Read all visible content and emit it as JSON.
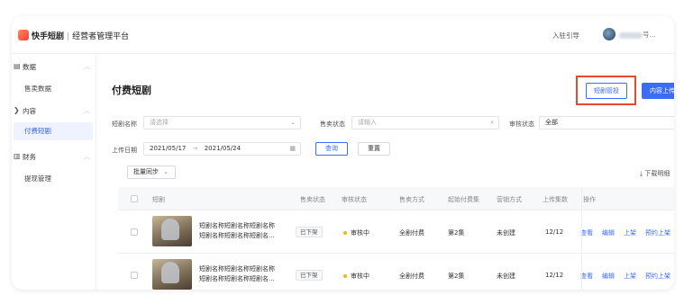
{
  "header": {
    "brand": "快手短剧",
    "separator": "|",
    "platform": "经营者管理平台",
    "entry_guide": "入驻引导",
    "username_suffix": "号..."
  },
  "sidebar": {
    "groups": [
      {
        "label": "数据",
        "icon": "chart-icon",
        "items": [
          "售卖数据"
        ]
      },
      {
        "label": "内容",
        "icon": "content-icon",
        "items": [
          "付费短剧"
        ]
      },
      {
        "label": "财务",
        "icon": "finance-icon",
        "items": [
          "提现管理"
        ]
      }
    ],
    "active_item": "付费短剧"
  },
  "page": {
    "title": "付费短剧",
    "manage_button": "短剧管投",
    "upload_button": "内容上传"
  },
  "filters": {
    "drama_name_label": "短剧名称",
    "drama_name_placeholder": "请选择",
    "sale_status_label": "售卖状态",
    "sale_status_placeholder": "请输入",
    "review_status_label": "审核状态",
    "review_status_value": "全部",
    "upload_date_label": "上传日期",
    "date_start": "2021/05/17",
    "date_arrow": "→",
    "date_end": "2021/05/24",
    "query_button": "查询",
    "reset_button": "重置"
  },
  "toolbar": {
    "batch_sync": "批量同步",
    "download_detail": "下载明细"
  },
  "table": {
    "columns": [
      "短剧",
      "售卖状态",
      "审核状态",
      "售卖方式",
      "起始付费集",
      "营销方式",
      "上传集数",
      "操作"
    ],
    "rows": [
      {
        "title_line1": "短剧名称短剧名称短剧名称",
        "title_line2": "短剧名称短剧名称短剧名...",
        "sale_status": "已下架",
        "review_status": "审核中",
        "sale_mode": "全剧付费",
        "start_paid_episode": "第2集",
        "marketing": "未创建",
        "episodes": "12/12",
        "actions": [
          "查看",
          "编辑",
          "上架",
          "预约上架"
        ]
      },
      {
        "title_line1": "短剧名称短剧名称短剧名称",
        "title_line2": "短剧名称短剧名称短剧名...",
        "sale_status": "已下架",
        "review_status": "审核中",
        "sale_mode": "全剧付费",
        "start_paid_episode": "第2集",
        "marketing": "未创建",
        "episodes": "12/12",
        "actions": [
          "查看",
          "编辑",
          "上架",
          "预约上架"
        ]
      }
    ]
  },
  "colors": {
    "primary": "#3a6cf4",
    "highlight_box": "#e84a2f",
    "review_dot": "#f4b400",
    "active_menu_bg": "#eef3ff"
  }
}
